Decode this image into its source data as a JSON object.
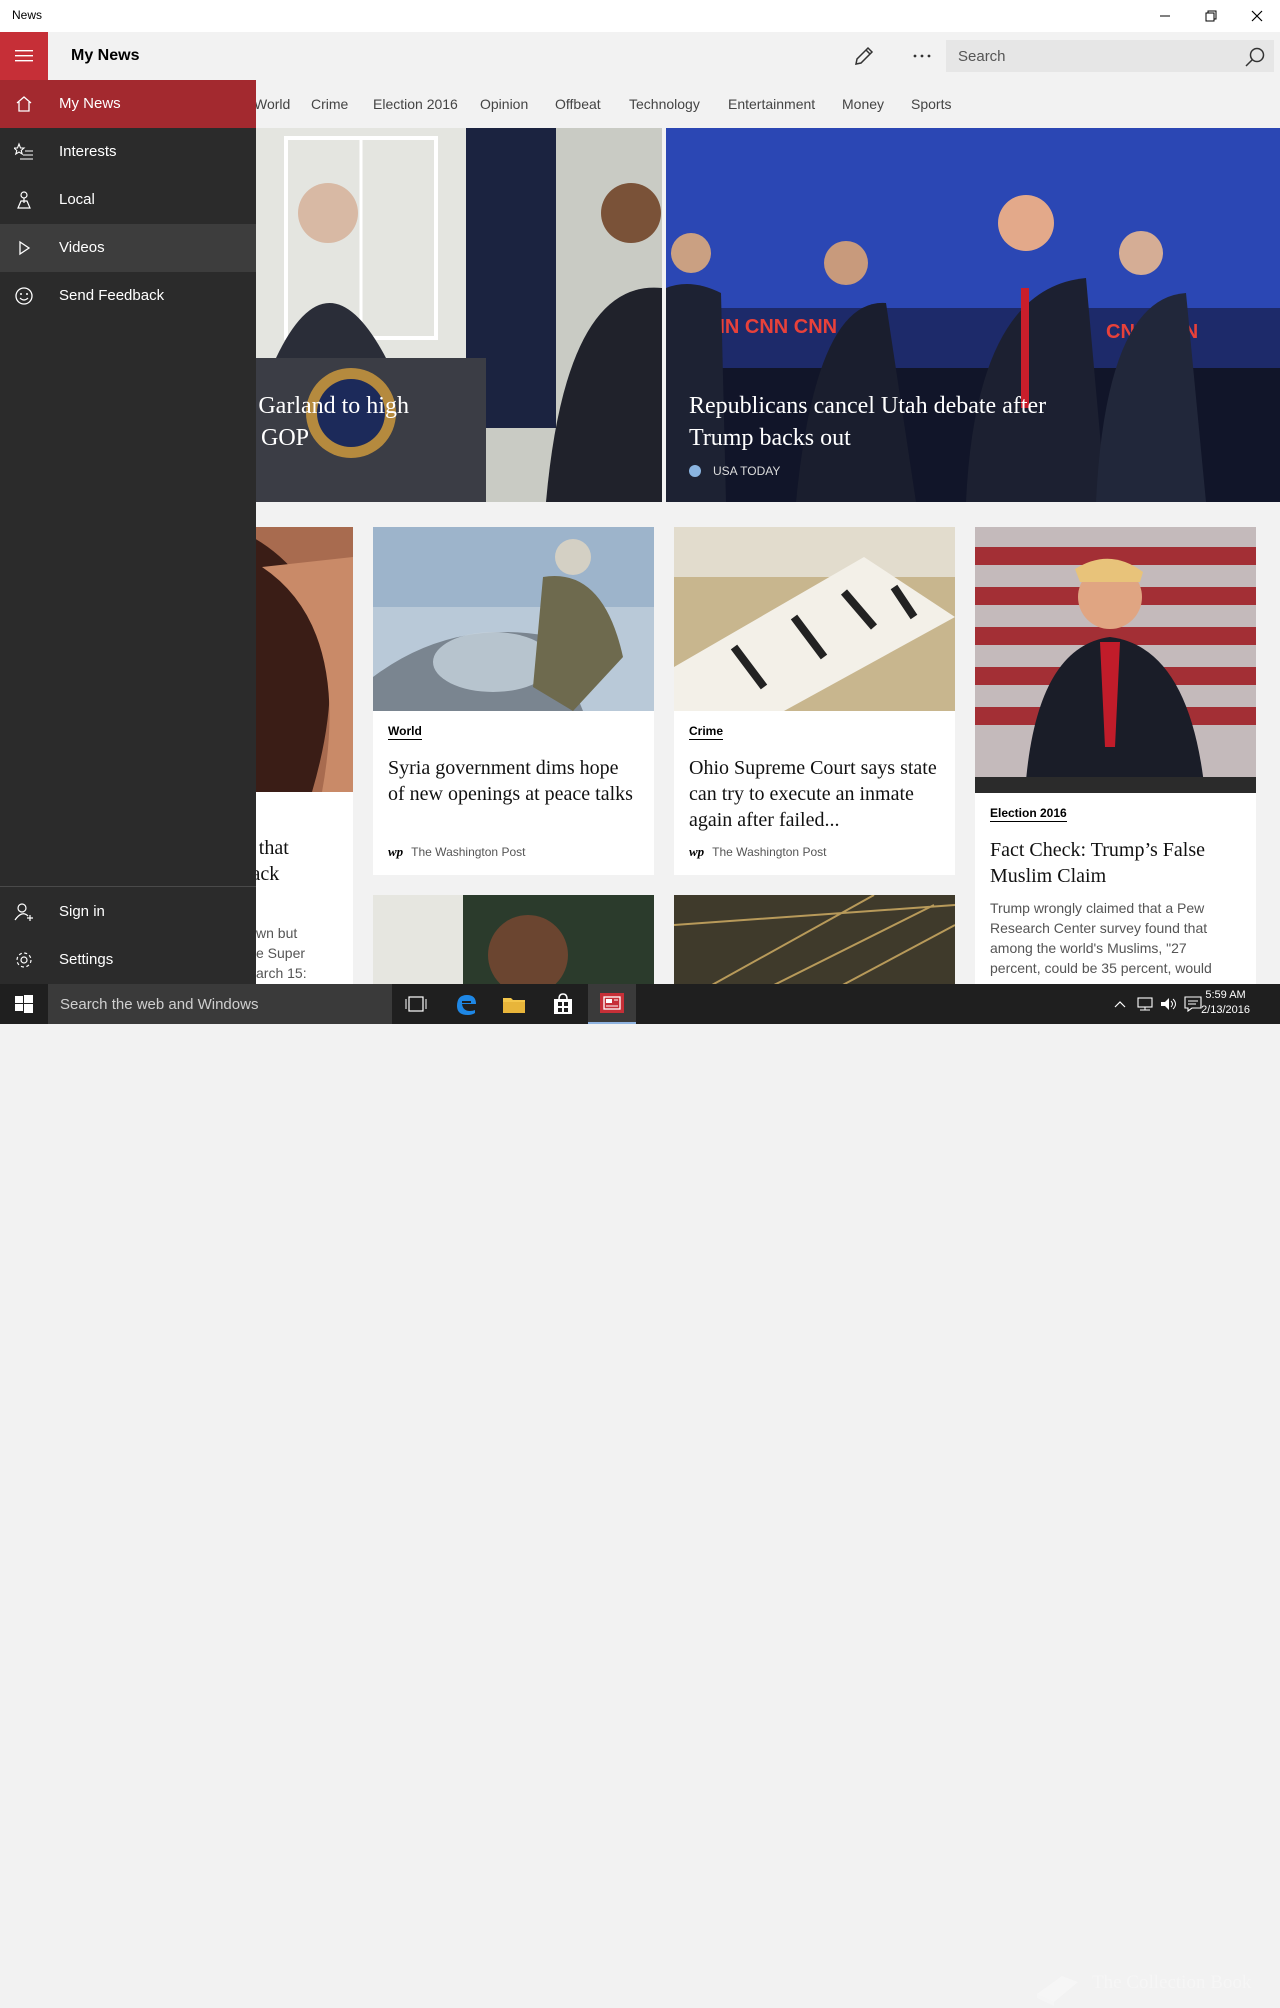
{
  "window": {
    "title": "News",
    "controls": [
      "minimize",
      "restore",
      "close"
    ]
  },
  "header": {
    "title": "My News",
    "search_placeholder": "Search"
  },
  "tabs": [
    "World",
    "Crime",
    "Election 2016",
    "Opinion",
    "Offbeat",
    "Technology",
    "Entertainment",
    "Money",
    "Sports"
  ],
  "nav": {
    "items": [
      {
        "label": "My News",
        "icon": "home-icon",
        "state": "active"
      },
      {
        "label": "Interests",
        "icon": "interests-icon"
      },
      {
        "label": "Local",
        "icon": "local-icon"
      },
      {
        "label": "Videos",
        "icon": "play-icon",
        "state": "hover"
      },
      {
        "label": "Send Feedback",
        "icon": "smiley-icon"
      }
    ],
    "bottom": [
      {
        "label": "Sign in",
        "icon": "person-add-icon"
      },
      {
        "label": "Settings",
        "icon": "gear-icon"
      }
    ]
  },
  "hero": [
    {
      "title_line1": "s Garland to high",
      "title_line2": "g GOP"
    },
    {
      "title_line1": "Republicans cancel Utah debate after",
      "title_line2": "Trump backs out",
      "source": "USA TODAY"
    }
  ],
  "cards": [
    {
      "partial_title_line1": "s that",
      "partial_title_line2": "lack",
      "partial_summary_line1": "wn but",
      "partial_summary_line2": "e Super",
      "partial_summary_line3": "arch 15:"
    },
    {
      "category": "World",
      "headline": "Syria government dims hope of new openings at peace talks",
      "source": "The Washington Post",
      "source_logo": "wp"
    },
    {
      "category": "Crime",
      "headline": "Ohio Supreme Court says state can try to execute an inmate again after failed...",
      "source": "The Washington Post",
      "source_logo": "wp"
    },
    {
      "category": "Election 2016",
      "headline": "Fact Check: Trump’s False Muslim Claim",
      "summary": "Trump wrongly claimed that a Pew Research Center survey found that among the world's Muslims, \"27 percent, could be 35 percent, would"
    }
  ],
  "taskbar": {
    "search_placeholder": "Search the web and Windows",
    "time": "5:59 AM",
    "date": "2/13/2016",
    "watermark": "The Collection Book"
  }
}
